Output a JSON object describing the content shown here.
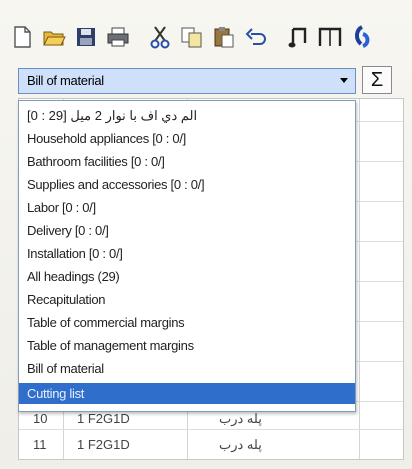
{
  "toolbar": {
    "buttons": [
      {
        "name": "new-document-icon"
      },
      {
        "name": "open-folder-icon"
      },
      {
        "name": "save-icon"
      },
      {
        "name": "print-icon"
      },
      {
        "name": "cut-icon"
      },
      {
        "name": "copy-icon"
      },
      {
        "name": "paste-icon"
      },
      {
        "name": "undo-icon"
      },
      {
        "name": "music-note-icon"
      },
      {
        "name": "bracket-tool-icon"
      },
      {
        "name": "app-logo-icon"
      }
    ]
  },
  "combo": {
    "selected": "Bill of material",
    "sigma_label": "Σ"
  },
  "dropdown": {
    "options": [
      {
        "label": "[0 : 29] الم دي اف با نوار 2 ميل"
      },
      {
        "label": "Household appliances [0 : 0/]"
      },
      {
        "label": "Bathroom facilities [0 : 0/]"
      },
      {
        "label": "Supplies and accessories [0 : 0/]"
      },
      {
        "label": "Labor [0 : 0/]"
      },
      {
        "label": "Delivery [0 : 0/]"
      },
      {
        "label": "Installation [0 : 0/]"
      },
      {
        "label": "All headings (29)"
      },
      {
        "label": "Recapitulation"
      },
      {
        "label": "Table of commercial margins"
      },
      {
        "label": "Table of management margins"
      },
      {
        "label": "Bill of material"
      },
      {
        "label": "Cutting list"
      }
    ],
    "selected_index": 12
  },
  "grid": {
    "rows": [
      {
        "num": "10",
        "code": "1 F2G1D",
        "desc": "پله درب"
      },
      {
        "num": "11",
        "code": "1 F2G1D",
        "desc": "پله درب"
      }
    ]
  },
  "colors": {
    "selection": "#2f6ecb",
    "combo_bg": "#cfe0fb"
  }
}
